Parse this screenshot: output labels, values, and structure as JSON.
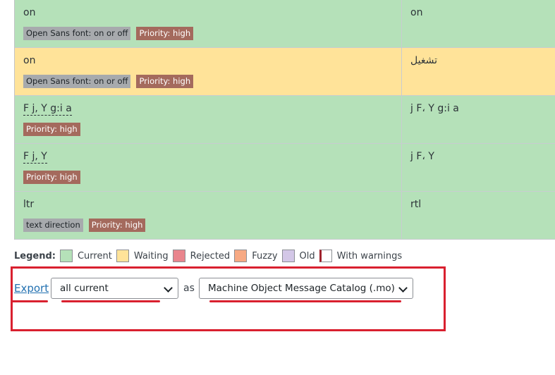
{
  "rows": [
    {
      "original": "on",
      "translation": "on",
      "tags": [
        "Open Sans font: on or off",
        "Priority: high"
      ]
    },
    {
      "original": "on",
      "translation": "تشغيل",
      "tags": [
        "Open Sans font: on or off",
        "Priority: high"
      ]
    },
    {
      "original": "F j, Y g:i a",
      "translation": "j F، Y g:i a",
      "tags": [
        "Priority: high"
      ]
    },
    {
      "original": "F j, Y",
      "translation": "j F، Y",
      "tags": [
        "Priority: high"
      ]
    },
    {
      "original": "ltr",
      "translation": "rtl",
      "tags": [
        "text direction",
        "Priority: high"
      ]
    }
  ],
  "legend": {
    "title": "Legend:",
    "items": [
      {
        "label": "Current",
        "color": "#b5e1b9"
      },
      {
        "label": "Waiting",
        "color": "#ffe399"
      },
      {
        "label": "Rejected",
        "color": "#e9858d"
      },
      {
        "label": "Fuzzy",
        "color": "#f7a983"
      },
      {
        "label": "Old",
        "color": "#d3c7e7"
      },
      {
        "label": "With warnings",
        "color": "#ffffff"
      }
    ]
  },
  "export": {
    "link": "Export",
    "filter_value": "all current",
    "as": "as",
    "format_value": "Machine Object Message Catalog (.mo)"
  },
  "colors": {
    "annotation": "#d9202f",
    "link": "#2271b1"
  }
}
